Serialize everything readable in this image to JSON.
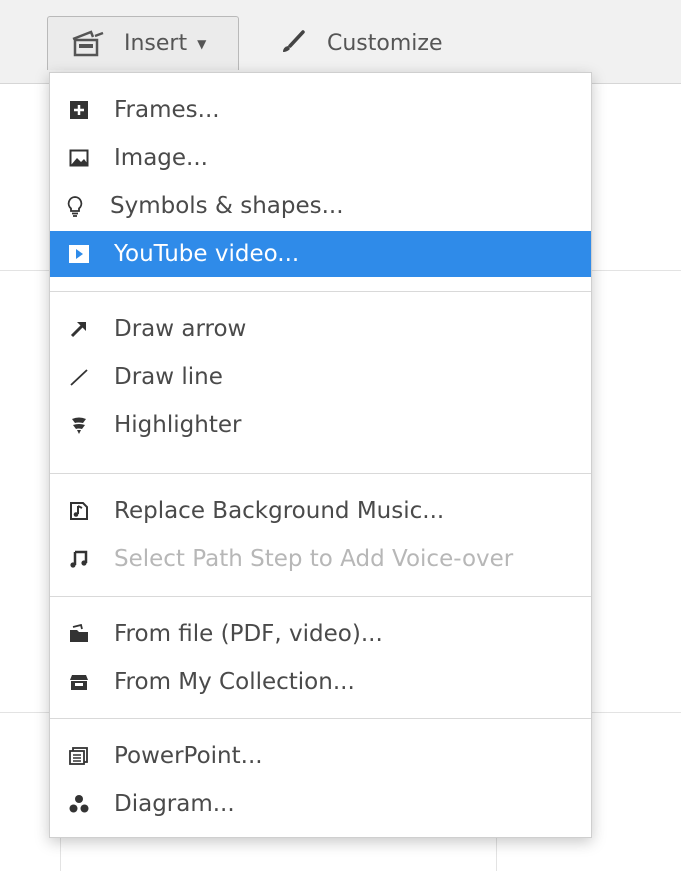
{
  "toolbar": {
    "insert_label": "Insert",
    "customize_label": "Customize"
  },
  "menu": {
    "groups": [
      {
        "items": [
          {
            "label": "Frames...",
            "icon": "frame-plus-icon"
          },
          {
            "label": "Image...",
            "icon": "image-icon"
          },
          {
            "label": "Symbols & shapes...",
            "icon": "lightbulb-icon"
          },
          {
            "label": "YouTube video...",
            "icon": "play-icon",
            "highlighted": true
          }
        ]
      },
      {
        "items": [
          {
            "label": "Draw arrow",
            "icon": "arrow-icon"
          },
          {
            "label": "Draw line",
            "icon": "line-icon"
          },
          {
            "label": "Highlighter",
            "icon": "highlighter-icon"
          }
        ]
      },
      {
        "items": [
          {
            "label": "Replace Background Music...",
            "icon": "music-file-icon"
          },
          {
            "label": "Select Path Step to Add Voice-over",
            "icon": "music-note-icon",
            "disabled": true
          }
        ]
      },
      {
        "items": [
          {
            "label": "From file (PDF, video)...",
            "icon": "folder-icon"
          },
          {
            "label": "From My Collection...",
            "icon": "collection-icon"
          }
        ]
      },
      {
        "items": [
          {
            "label": "PowerPoint...",
            "icon": "powerpoint-icon"
          },
          {
            "label": "Diagram...",
            "icon": "diagram-icon"
          }
        ]
      }
    ]
  },
  "colors": {
    "highlight": "#2f8be9",
    "text": "#4a4a4a",
    "disabled_text": "#b7b7b7",
    "toolbar_bg": "#f1f1f1"
  }
}
